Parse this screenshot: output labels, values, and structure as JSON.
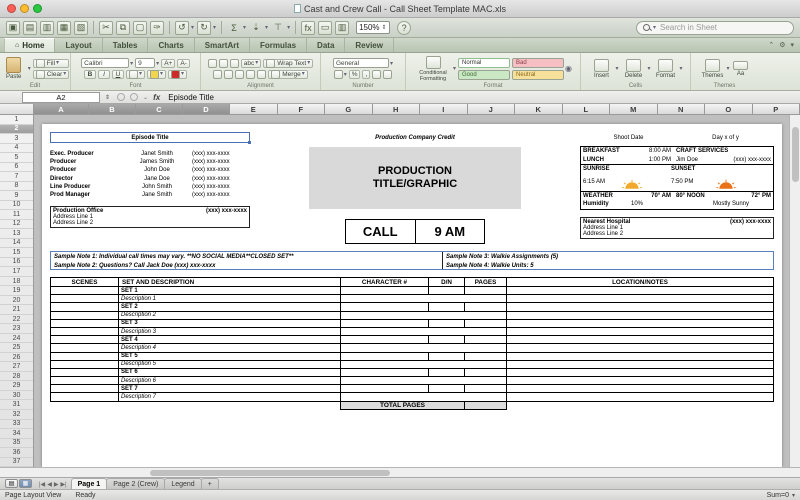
{
  "window": {
    "title": "Cast and Crew Call - Call Sheet Template MAC.xls",
    "doc_icon": "spreadsheet-icon"
  },
  "toolbar": {
    "icons": [
      "new-icon",
      "open-icon",
      "save-as-icon",
      "save-icon",
      "print-icon",
      "cut-icon",
      "copy-icon",
      "paste-icon",
      "format-painter-icon",
      "undo-icon",
      "redo-icon",
      "autosum-icon",
      "sort-icon",
      "filter-icon",
      "function-icon",
      "gallery-icon",
      "chart-icon"
    ],
    "zoom_value": "150%",
    "help_icon": "help-icon",
    "search_placeholder": "Search in Sheet",
    "search_icon": "search-icon"
  },
  "ribbon": {
    "tabs": [
      {
        "label": "Home",
        "active": true,
        "icon": "home-icon"
      },
      {
        "label": "Layout",
        "active": false
      },
      {
        "label": "Tables",
        "active": false
      },
      {
        "label": "Charts",
        "active": false
      },
      {
        "label": "SmartArt",
        "active": false
      },
      {
        "label": "Formulas",
        "active": false
      },
      {
        "label": "Data",
        "active": false
      },
      {
        "label": "Review",
        "active": false
      }
    ],
    "collapse_icon": "chevron-up-icon",
    "settings_icon": "gear-icon",
    "groups": {
      "edit": {
        "label": "Edit",
        "paste": "Paste",
        "fill": "Fill",
        "clear": "Clear"
      },
      "font": {
        "label": "Font",
        "family": "Calibri",
        "size": "9",
        "grow": "A+",
        "shrink": "A-",
        "bold": "B",
        "italic": "I",
        "underline": "U",
        "borders_icon": "borders-icon",
        "fill_color_icon": "fill-color-icon",
        "font_color_icon": "font-color-icon"
      },
      "alignment": {
        "label": "Alignment",
        "abc": "abc",
        "wrap_text": "Wrap Text",
        "merge": "Merge",
        "align_left_icon": "align-left-icon",
        "align_center_icon": "align-center-icon",
        "align_right_icon": "align-right-icon",
        "indent_decrease_icon": "indent-decrease-icon",
        "indent_increase_icon": "indent-increase-icon"
      },
      "number": {
        "label": "Number",
        "format": "General",
        "percent": "%",
        "comma": ",",
        "increase_decimal_icon": "increase-decimal-icon",
        "decrease_decimal_icon": "decrease-decimal-icon"
      },
      "format": {
        "label": "Format",
        "conditional_formatting": "Conditional Formatting",
        "styles": [
          "Normal",
          "Bad",
          "Good",
          "Neutral"
        ],
        "more_icon": "more-styles-icon"
      },
      "cells": {
        "label": "Cells",
        "insert": "Insert",
        "delete": "Delete",
        "format": "Format"
      },
      "themes": {
        "label": "Themes",
        "themes": "Themes",
        "aa": "Aa"
      }
    }
  },
  "formula_bar": {
    "name_box": "A2",
    "value": "Episode Title",
    "fx_label": "fx",
    "cancel_icon": "cancel-icon",
    "accept_icon": "accept-icon"
  },
  "grid": {
    "columns": [
      "A",
      "B",
      "C",
      "D",
      "E",
      "F",
      "G",
      "H",
      "I",
      "J",
      "K",
      "L",
      "M",
      "N",
      "O",
      "P"
    ],
    "selected_columns": [
      "A",
      "B",
      "C",
      "D"
    ],
    "rows": [
      1,
      2,
      3,
      4,
      5,
      6,
      7,
      8,
      9,
      10,
      11,
      12,
      13,
      14,
      15,
      16,
      17,
      18,
      19,
      20,
      21,
      22,
      23,
      24,
      25,
      26,
      27,
      28,
      29,
      30,
      31,
      32,
      33,
      34,
      35,
      36,
      37
    ],
    "selected_row": 2
  },
  "callsheet": {
    "episode_title": "Episode Title",
    "production_company_credit": "Production Company Credit",
    "shoot_date_label": "Shoot Date",
    "day_label": "Day x of y",
    "crew": [
      {
        "role": "Exec. Producer",
        "name": "Janet Smith",
        "phone": "(xxx) xxx-xxxx"
      },
      {
        "role": "Producer",
        "name": "James Smith",
        "phone": "(xxx) xxx-xxxx"
      },
      {
        "role": "Producer",
        "name": "John Doe",
        "phone": "(xxx) xxx-xxxx"
      },
      {
        "role": "Director",
        "name": "Jane Doe",
        "phone": "(xxx) xxx-xxxx"
      },
      {
        "role": "Line Producer",
        "name": "John Smith",
        "phone": "(xxx) xxx-xxxx"
      },
      {
        "role": "Prod Manager",
        "name": "Jane Smith",
        "phone": "(xxx) xxx-xxxx"
      }
    ],
    "production_office": {
      "title": "Production Office",
      "phone": "(xxx) xxx-xxxx",
      "line1": "Address Line 1",
      "line2": "Address Line 2"
    },
    "graphic_line1": "PRODUCTION",
    "graphic_line2": "TITLE/GRAPHIC",
    "call_label": "CALL",
    "call_time": "9 AM",
    "meals": {
      "breakfast_label": "BREAKFAST",
      "breakfast_time": "8:00 AM",
      "lunch_label": "LUNCH",
      "lunch_time": "1:00 PM",
      "craft_services_label": "CRAFT SERVICES",
      "craft_name": "Jim Doe",
      "craft_phone": "(xxx) xxx-xxxx"
    },
    "sun": {
      "sunrise_label": "SUNRISE",
      "sunrise_time": "6:15 AM",
      "sunset_label": "SUNSET",
      "sunset_time": "7:50 PM",
      "sunrise_icon": "sunrise-icon",
      "sunset_icon": "sunset-icon"
    },
    "weather": {
      "label": "WEATHER",
      "am_temp": "70° AM",
      "noon_temp": "80° NOON",
      "pm_temp": "72° PM",
      "humidity_label": "Humidity",
      "humidity_value": "10%",
      "condition": "Mostly Sunny"
    },
    "hospital": {
      "title": "Nearest Hospital",
      "phone": "(xxx) xxx-xxxx",
      "line1": "Address Line 1",
      "line2": "Address Line 2"
    },
    "notes_left": [
      "Sample Note 1: Individual call times may vary.  **NO SOCIAL MEDIA**CLOSED SET**",
      "Sample Note 2: Questions?  Call Jack Doe (xxx) xxx-xxxx"
    ],
    "notes_right": [
      "Sample Note 3: Walkie Assignments (5)",
      "Sample Note 4: Walkie Units: 5"
    ],
    "scene_table": {
      "headers": [
        "SCENES",
        "SET AND DESCRIPTION",
        "CHARACTER #",
        "D/N",
        "PAGES",
        "LOCATION/NOTES"
      ],
      "rows": [
        {
          "set": "SET 1",
          "description": "Description 1"
        },
        {
          "set": "SET 2",
          "description": "Description 2"
        },
        {
          "set": "SET 3",
          "description": "Description 3"
        },
        {
          "set": "SET 4",
          "description": "Description 4"
        },
        {
          "set": "SET 5",
          "description": "Description 5"
        },
        {
          "set": "SET 6",
          "description": "Description 6"
        },
        {
          "set": "SET 7",
          "description": "Description 7"
        }
      ],
      "total_label": "TOTAL PAGES"
    }
  },
  "sheet_tabs": {
    "tabs": [
      {
        "label": "Page 1",
        "active": true
      },
      {
        "label": "Page 2 (Crew)",
        "active": false
      },
      {
        "label": "Legend",
        "active": false
      }
    ],
    "add_label": "+",
    "nav_first": "|◀",
    "nav_prev": "◀",
    "nav_next": "▶",
    "nav_last": "▶|",
    "view_normal_icon": "normal-view-icon",
    "view_layout_icon": "page-layout-view-icon"
  },
  "status_bar": {
    "view_mode": "Page Layout View",
    "state": "Ready",
    "sum": "Sum=0"
  }
}
